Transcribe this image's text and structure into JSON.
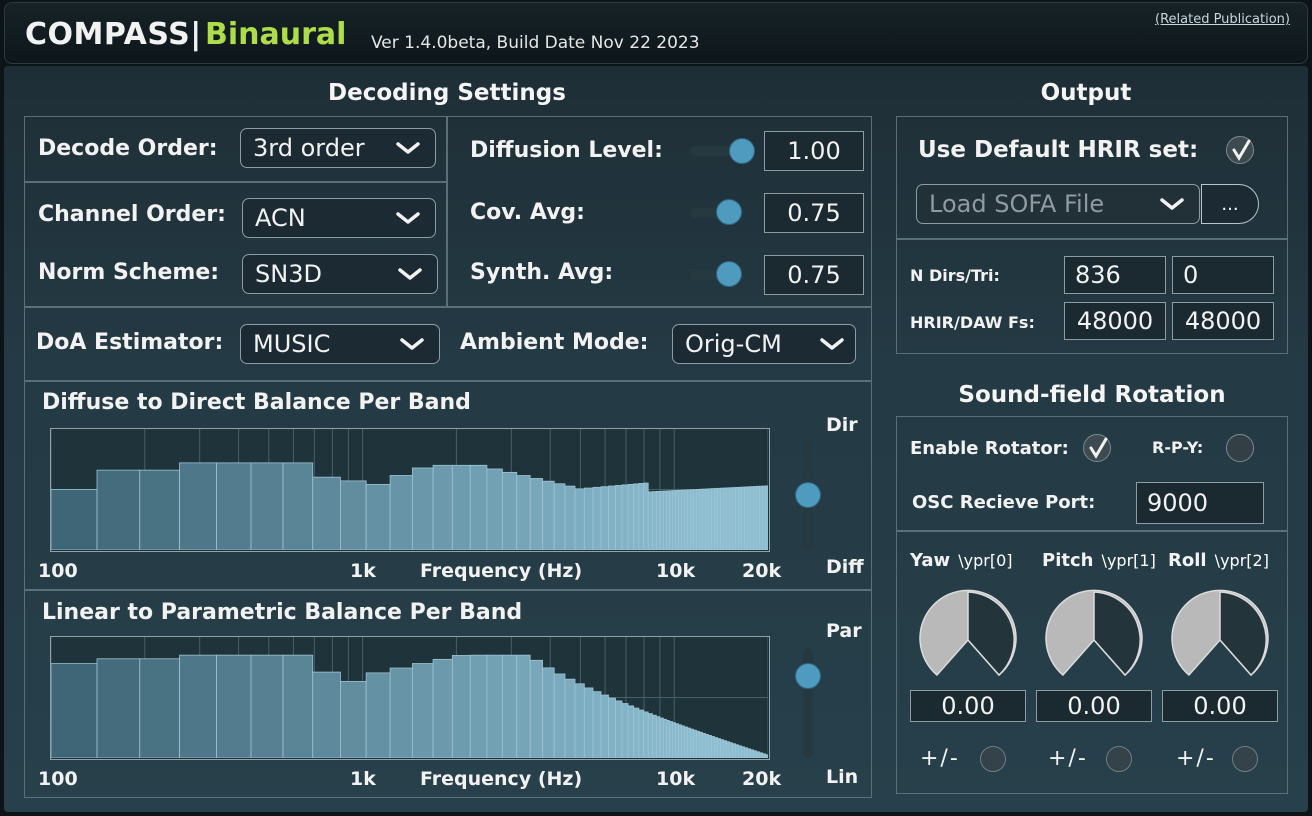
{
  "header": {
    "app_name": "COMPASS|",
    "app_variant": "Binaural",
    "version": "Ver 1.4.0beta, Build Date Nov 22 2023",
    "related_link": "(Related Publication)"
  },
  "decoding": {
    "title": "Decoding Settings",
    "decode_order": {
      "label": "Decode Order:",
      "value": "3rd order"
    },
    "channel_order": {
      "label": "Channel Order:",
      "value": "ACN"
    },
    "norm_scheme": {
      "label": "Norm Scheme:",
      "value": "SN3D"
    },
    "diffusion_level": {
      "label": "Diffusion Level:",
      "value": "1.00",
      "fraction": 1.0
    },
    "cov_avg": {
      "label": "Cov. Avg:",
      "value": "0.75",
      "fraction": 0.75
    },
    "synth_avg": {
      "label": "Synth. Avg:",
      "value": "0.75",
      "fraction": 0.75
    },
    "doa_estimator": {
      "label": "DoA Estimator:",
      "value": "MUSIC"
    },
    "ambient_mode": {
      "label": "Ambient Mode:",
      "value": "Orig-CM"
    }
  },
  "plots": {
    "diffuse": {
      "title": "Diffuse to Direct Balance Per Band",
      "top_label": "Dir",
      "bottom_label": "Diff",
      "slider_fraction": 0.5,
      "x_ticks": [
        "100",
        "1k",
        "10k",
        "20k"
      ],
      "x_label": "Frequency (Hz)"
    },
    "linear": {
      "title": "Linear to Parametric Balance Per Band",
      "top_label": "Par",
      "bottom_label": "Lin",
      "slider_fraction": 0.75,
      "x_ticks": [
        "100",
        "1k",
        "10k",
        "20k"
      ],
      "x_label": "Frequency (Hz)"
    }
  },
  "output": {
    "title": "Output",
    "use_default_hrir": {
      "label": "Use Default HRIR set:",
      "checked": true
    },
    "load_sofa": "Load SOFA File",
    "browse_label": "...",
    "n_dirs_tri": {
      "label": "N Dirs/Tri:",
      "dirs": "836",
      "tri": "0"
    },
    "hrir_daw_fs": {
      "label": "HRIR/DAW Fs:",
      "hrir": "48000",
      "daw": "48000"
    }
  },
  "rotation": {
    "title": "Sound-field Rotation",
    "enable_rotator": {
      "label": "Enable Rotator:",
      "checked": true
    },
    "rpy": {
      "label": "R-P-Y:",
      "checked": false
    },
    "osc_port": {
      "label": "OSC Recieve Port:",
      "value": "9000"
    },
    "knobs": [
      {
        "name": "Yaw",
        "osc": "\\ypr[0]",
        "value": "0.00",
        "flip_label": "+/-"
      },
      {
        "name": "Pitch",
        "osc": "\\ypr[1]",
        "value": "0.00",
        "flip_label": "+/-"
      },
      {
        "name": "Roll",
        "osc": "\\ypr[2]",
        "value": "0.00",
        "flip_label": "+/-"
      }
    ]
  },
  "colors": {
    "accent_green": "#aedd4a",
    "slider_thumb": "#4f9bbf",
    "bar_fill": "#3f6677",
    "knob_fill": "#b9b9b9"
  }
}
